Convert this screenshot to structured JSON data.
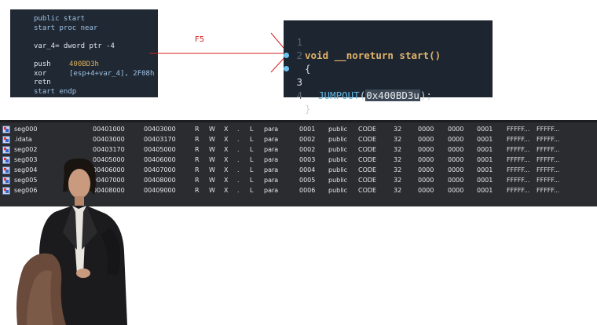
{
  "disassembly": {
    "lines": [
      {
        "kind": "label",
        "text": "public start"
      },
      {
        "kind": "label",
        "text": "start proc near"
      },
      {
        "kind": "blank",
        "text": ""
      },
      {
        "kind": "var",
        "text": "var_4= dword ptr -4"
      },
      {
        "kind": "blank",
        "text": ""
      },
      {
        "kind": "instr",
        "mnemonic": "push",
        "operand": "400BD3h",
        "operand_kind": "num"
      },
      {
        "kind": "instr",
        "mnemonic": "xor",
        "operand": "[esp+4+var_4], 2F08h",
        "operand_kind": "mem"
      },
      {
        "kind": "instr",
        "mnemonic": "retn",
        "operand": "",
        "operand_kind": "none"
      },
      {
        "kind": "label",
        "text": "start endp"
      }
    ]
  },
  "arrow": {
    "label": "F5",
    "color": "#d42020"
  },
  "pseudocode": {
    "line_numbers": [
      "1",
      "2",
      "3",
      "4"
    ],
    "active_line": "3",
    "l1": {
      "kw": "void",
      "fn": "__noreturn start",
      "parens": "()"
    },
    "l2": {
      "text": "{"
    },
    "l3": {
      "call": "JUMPOUT",
      "open": "(",
      "arg_pre": "0x4",
      "arg_sel": "00BD3u",
      "close": ");"
    },
    "l4": {
      "text": "}"
    }
  },
  "segments": {
    "rows": [
      {
        "name": "seg000",
        "start": "00401000",
        "end": "00403000",
        "r": "R",
        "w": "W",
        "x": "X",
        "d": ".",
        "l": "L",
        "align": "para",
        "base": "0001",
        "type": "public",
        "class": "CODE",
        "bits": "32",
        "es": "0000",
        "ss": "0000",
        "ds": "0001",
        "fs": "FFFFF...",
        "gs": "FFFFF..."
      },
      {
        "name": ".idata",
        "start": "00403000",
        "end": "00403170",
        "r": "R",
        "w": "W",
        "x": "X",
        "d": ".",
        "l": "L",
        "align": "para",
        "base": "0002",
        "type": "public",
        "class": "CODE",
        "bits": "32",
        "es": "0000",
        "ss": "0000",
        "ds": "0001",
        "fs": "FFFFF...",
        "gs": "FFFFF..."
      },
      {
        "name": "seg002",
        "start": "00403170",
        "end": "00405000",
        "r": "R",
        "w": "W",
        "x": "X",
        "d": ".",
        "l": "L",
        "align": "para",
        "base": "0002",
        "type": "public",
        "class": "CODE",
        "bits": "32",
        "es": "0000",
        "ss": "0000",
        "ds": "0001",
        "fs": "FFFFF...",
        "gs": "FFFFF..."
      },
      {
        "name": "seg003",
        "start": "00405000",
        "end": "00406000",
        "r": "R",
        "w": "W",
        "x": "X",
        "d": ".",
        "l": "L",
        "align": "para",
        "base": "0003",
        "type": "public",
        "class": "CODE",
        "bits": "32",
        "es": "0000",
        "ss": "0000",
        "ds": "0001",
        "fs": "FFFFF...",
        "gs": "FFFFF..."
      },
      {
        "name": "seg004",
        "start": "00406000",
        "end": "00407000",
        "r": "R",
        "w": "W",
        "x": "X",
        "d": ".",
        "l": "L",
        "align": "para",
        "base": "0004",
        "type": "public",
        "class": "CODE",
        "bits": "32",
        "es": "0000",
        "ss": "0000",
        "ds": "0001",
        "fs": "FFFFF...",
        "gs": "FFFFF..."
      },
      {
        "name": "seg005",
        "start": "00407000",
        "end": "00408000",
        "r": "R",
        "w": "W",
        "x": "X",
        "d": ".",
        "l": "L",
        "align": "para",
        "base": "0005",
        "type": "public",
        "class": "CODE",
        "bits": "32",
        "es": "0000",
        "ss": "0000",
        "ds": "0001",
        "fs": "FFFFF...",
        "gs": "FFFFF..."
      },
      {
        "name": "seg006",
        "start": "00408000",
        "end": "00409000",
        "r": "R",
        "w": "W",
        "x": "X",
        "d": ".",
        "l": "L",
        "align": "para",
        "base": "0006",
        "type": "public",
        "class": "CODE",
        "bits": "32",
        "es": "0000",
        "ss": "0000",
        "ds": "0001",
        "fs": "FFFFF...",
        "gs": "FFFFF..."
      }
    ]
  },
  "meme": {
    "icon": "confused-man-illustration"
  }
}
